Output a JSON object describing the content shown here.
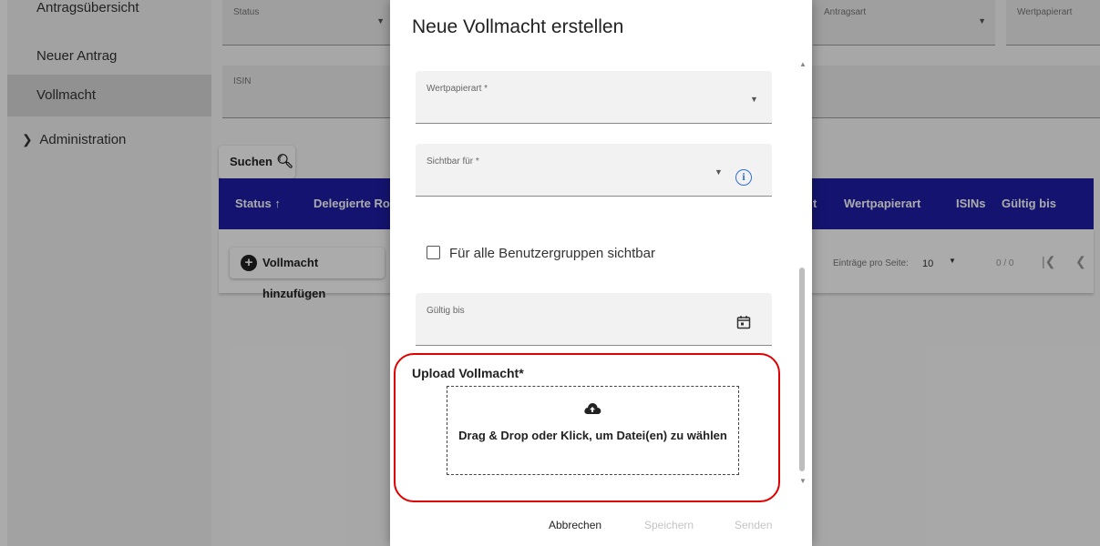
{
  "sidebar": {
    "items": [
      {
        "label": "Antragsübersicht"
      },
      {
        "label": "Neuer Antrag"
      },
      {
        "label": "Vollmacht"
      },
      {
        "label": "Administration"
      }
    ]
  },
  "filters": {
    "status_label": "Status",
    "antragsart_label": "Antragsart",
    "wertpapierart_label": "Wertpapierart",
    "isin_label": "ISIN"
  },
  "search_button": "Suchen",
  "table": {
    "columns": [
      "Status ↑",
      "Delegierte Ro",
      "t",
      "Wertpapierart",
      "ISINs",
      "Gültig bis"
    ],
    "add_button": "Vollmacht hinzufügen",
    "per_page_label": "Einträge pro Seite:",
    "per_page_value": "10",
    "count": "0 / 0"
  },
  "dialog": {
    "title": "Neue Vollmacht erstellen",
    "wertpapierart_label": "Wertpapierart *",
    "sichtbar_label": "Sichtbar für *",
    "checkbox_label": "Für alle Benutzergruppen sichtbar",
    "gueltig_label": "Gültig bis",
    "upload_label": "Upload Vollmacht*",
    "dropzone_text": "Drag & Drop oder Klick, um Datei(en) zu wählen",
    "buttons": {
      "cancel": "Abbrechen",
      "save": "Speichern",
      "send": "Senden"
    }
  },
  "colors": {
    "table_header": "#1e1ea8",
    "highlight": "#e00000",
    "info": "#2f6fd8"
  }
}
